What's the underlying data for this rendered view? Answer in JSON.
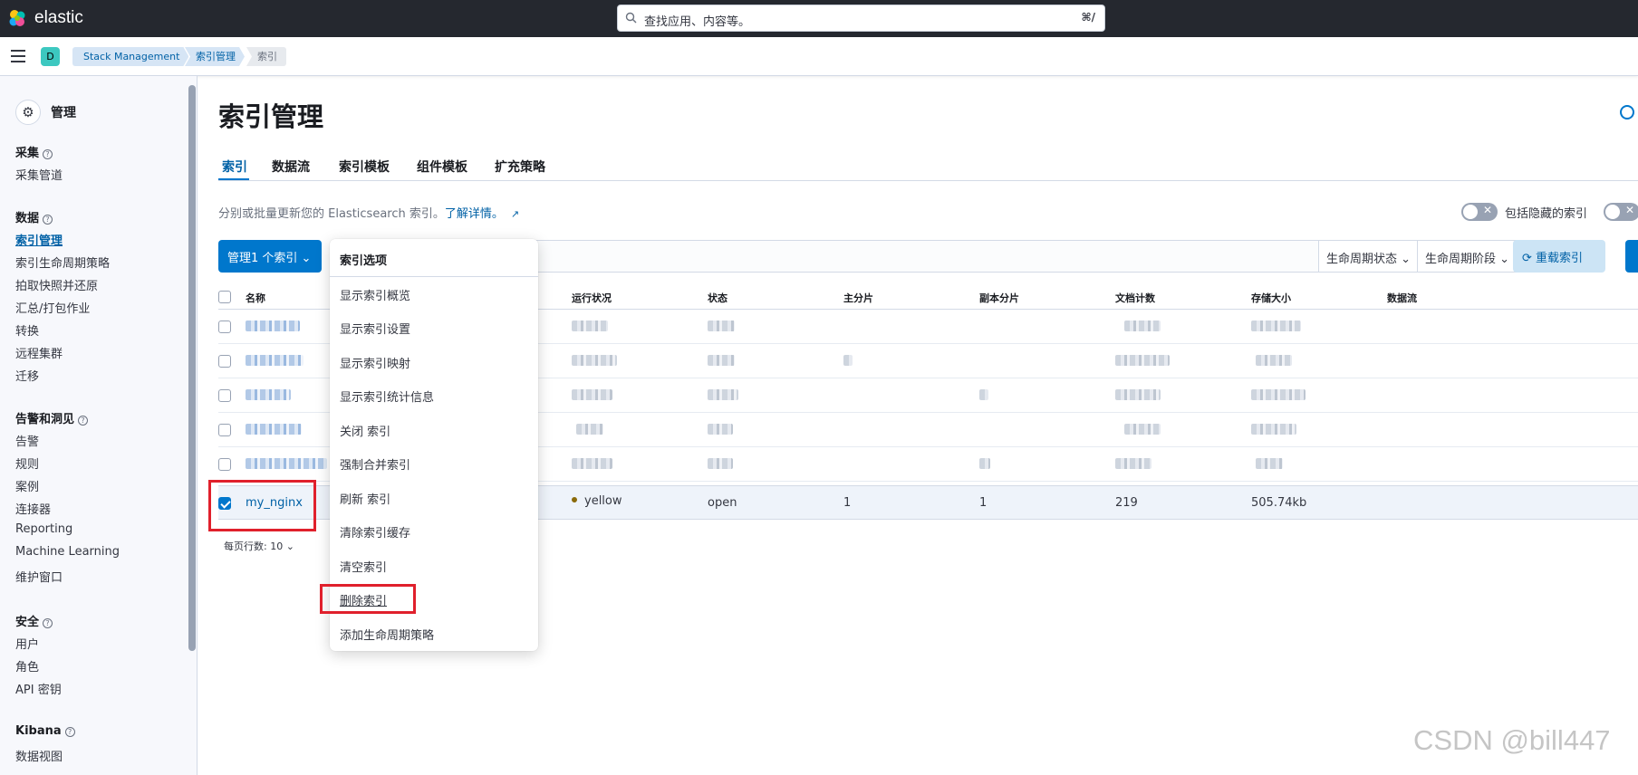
{
  "topbar": {
    "brand": "elastic",
    "search_placeholder": "查找应用、内容等。",
    "search_shortcut": "⌘/"
  },
  "breadcrumb": {
    "space_initial": "D",
    "items": [
      "Stack Management",
      "索引管理",
      "索引"
    ]
  },
  "sidebar": {
    "title": "管理",
    "groups": [
      {
        "label": "采集",
        "items": [
          "采集管道"
        ]
      },
      {
        "label": "数据",
        "items": [
          "索引管理",
          "索引生命周期策略",
          "拍取快照并还原",
          "汇总/打包作业",
          "转换",
          "远程集群",
          "迁移"
        ]
      },
      {
        "label": "告警和洞见",
        "items": [
          "告警",
          "规则",
          "案例",
          "连接器",
          "Reporting",
          "Machine Learning",
          "维护窗口"
        ]
      },
      {
        "label": "安全",
        "items": [
          "用户",
          "角色",
          "API 密钥"
        ]
      },
      {
        "label": "Kibana",
        "items": [
          "数据视图"
        ]
      }
    ],
    "active_item": "索引管理"
  },
  "page": {
    "title": "索引管理",
    "tabs": [
      "索引",
      "数据流",
      "索引模板",
      "组件模板",
      "扩充策略"
    ],
    "description": "分别或批量更新您的 Elasticsearch 索引。",
    "learn_more": "了解详情。",
    "toggle_hidden_label": "包括隐藏的索引",
    "manage_button": "管理1 个索引",
    "filter_lifecycle_status": "生命周期状态",
    "filter_lifecycle_phase": "生命周期阶段",
    "reload_button": "重载索引",
    "rows_per_page": "每页行数: 10"
  },
  "table": {
    "columns": [
      "名称",
      "运行状况",
      "状态",
      "主分片",
      "副本分片",
      "文档计数",
      "存储大小",
      "数据流"
    ],
    "selected_row": {
      "name": "my_nginx",
      "health": "yellow",
      "status": "open",
      "primary": "1",
      "replicas": "1",
      "docs": "219",
      "size": "505.74kb"
    }
  },
  "popover": {
    "title": "索引选项",
    "items": [
      "显示索引概览",
      "显示索引设置",
      "显示索引映射",
      "显示索引统计信息",
      "关闭 索引",
      "强制合并索引",
      "刷新 索引",
      "清除索引缓存",
      "清空索引",
      "删除索引",
      "添加生命周期策略"
    ]
  },
  "watermark": "CSDN @bill447",
  "colors": {
    "primary": "#0077cc",
    "highlight": "#e0202c",
    "topbar": "#25282f"
  }
}
